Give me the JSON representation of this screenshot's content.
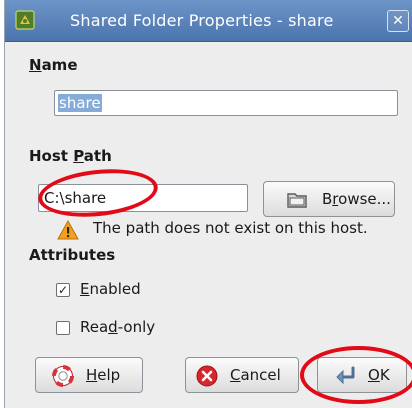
{
  "window": {
    "title": "Shared Folder Properties - share",
    "close_glyph": "✕"
  },
  "name_section": {
    "label": "Name",
    "value": "share"
  },
  "host_path_section": {
    "label": "Host Path",
    "path_value": "C:\\share",
    "browse_label": "Browse...",
    "warning_text": "The path does not exist on this host."
  },
  "attributes_section": {
    "label": "Attributes",
    "enabled_label": "Enabled",
    "enabled_checked": true,
    "readonly_label": "Read-only",
    "readonly_checked": false
  },
  "buttons": {
    "help": "Help",
    "cancel": "Cancel",
    "ok": "OK"
  },
  "colors": {
    "titlebar": "#5a82ba",
    "annotation": "#e10a16",
    "selection": "#86abd9"
  },
  "icons": [
    "app-icon",
    "close-icon",
    "folder-icon",
    "warning-icon",
    "help-icon",
    "cancel-icon",
    "ok-icon"
  ]
}
